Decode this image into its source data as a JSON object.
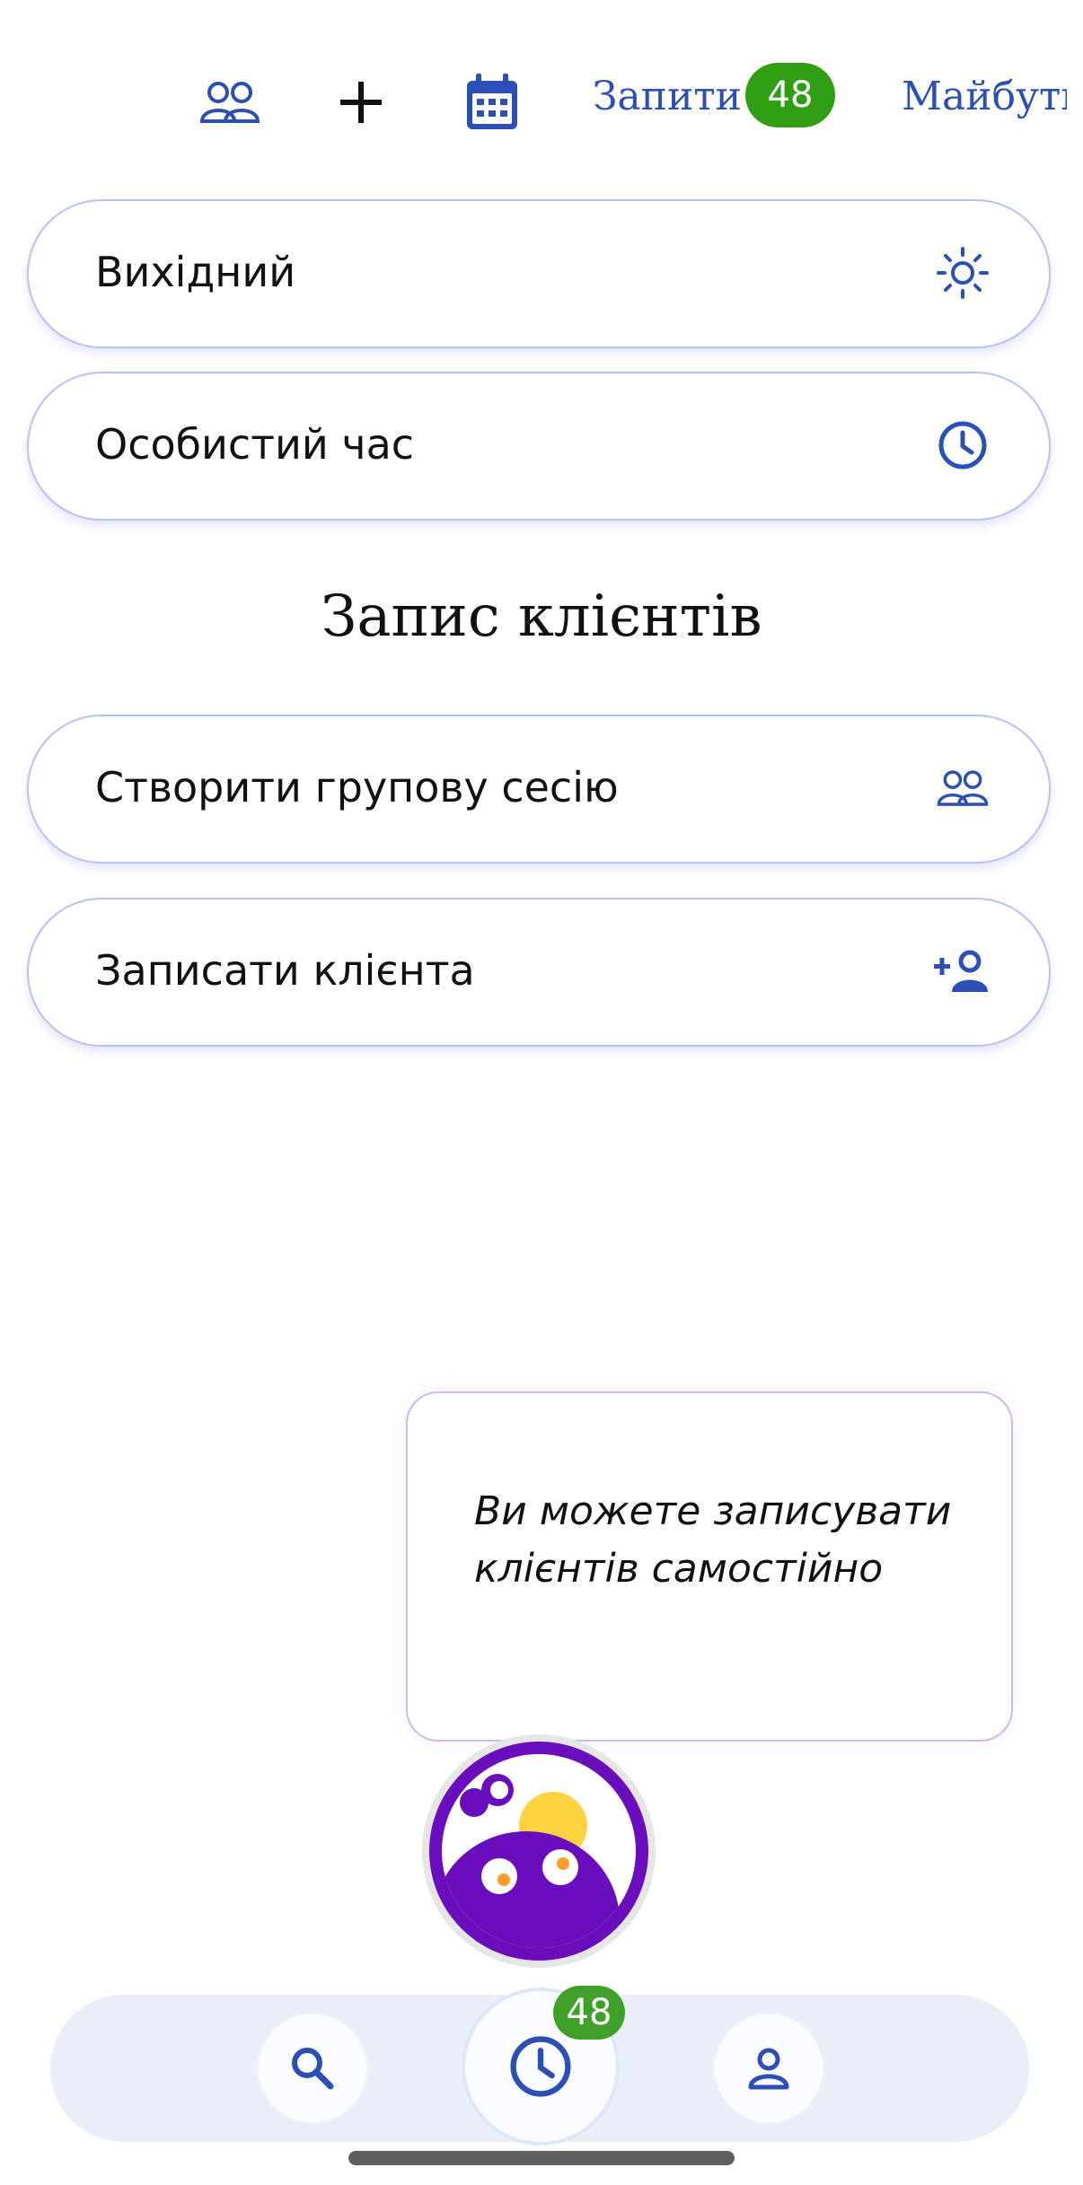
{
  "topbar": {
    "groups_icon": "people-icon",
    "add_icon": "plus-icon",
    "calendar_icon": "calendar-icon",
    "requests_label": "Запити",
    "requests_count": "48",
    "upcoming_label": "Майбутні"
  },
  "cards": {
    "day_off": {
      "label": "Вихідний",
      "icon": "sun-icon"
    },
    "personal_time": {
      "label": "Особистий час",
      "icon": "clock-icon"
    }
  },
  "section": {
    "title": "Запис клієнтів"
  },
  "client_cards": {
    "group_session": {
      "label": "Створити групову сесію",
      "icon": "people-icon"
    },
    "book_client": {
      "label": "Записати клієнта",
      "icon": "add-user-icon"
    }
  },
  "tooltip": {
    "text": "Ви можете записувати клієнтів самостійно"
  },
  "bottom_nav": {
    "search_icon": "search-icon",
    "schedule_icon": "clock-icon",
    "schedule_badge": "48",
    "profile_icon": "person-icon"
  },
  "colors": {
    "accent": "#2c4fb6",
    "badge": "#2f9e12",
    "mascot": "#6a0dbd",
    "sun": "#ffd23f"
  }
}
